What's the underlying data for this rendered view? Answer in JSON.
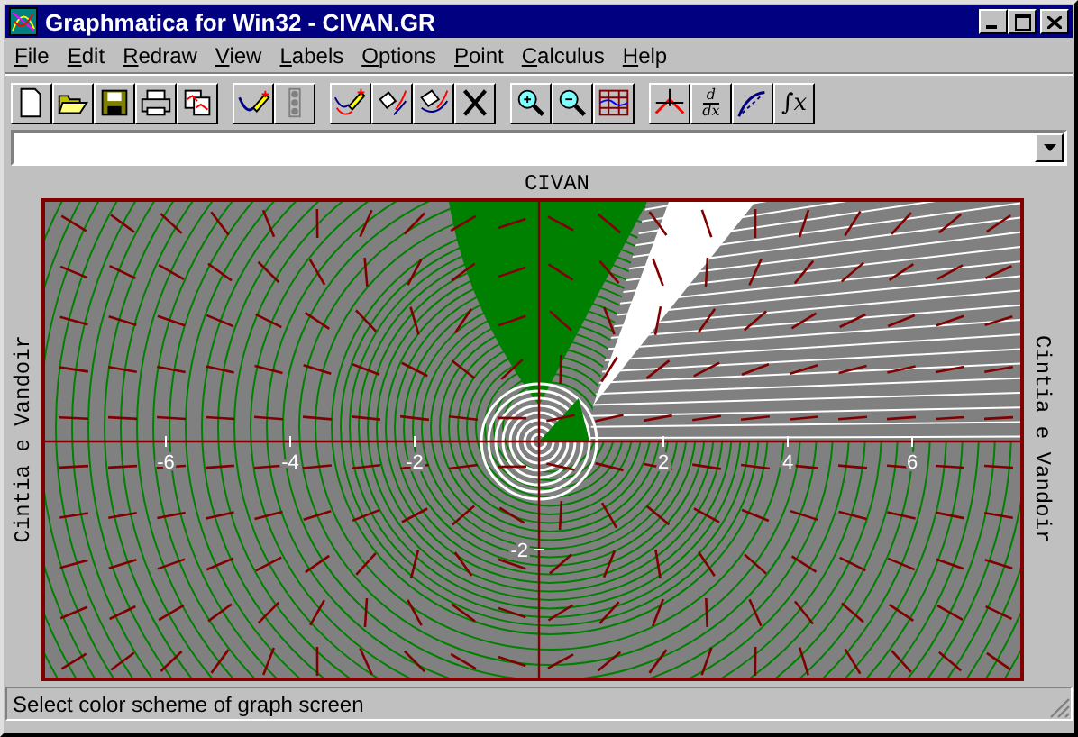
{
  "window": {
    "title": "Graphmatica for Win32 - CIVAN.GR"
  },
  "menu": [
    {
      "label": "File"
    },
    {
      "label": "Edit"
    },
    {
      "label": "Redraw"
    },
    {
      "label": "View"
    },
    {
      "label": "Labels"
    },
    {
      "label": "Options"
    },
    {
      "label": "Point"
    },
    {
      "label": "Calculus"
    },
    {
      "label": "Help"
    }
  ],
  "toolbar": {
    "derivative_button": {
      "numerator": "d",
      "denominator": "dx"
    },
    "integral_button": {
      "label": "∫x"
    }
  },
  "graph": {
    "title": "CIVAN",
    "left_label": "Cintia e Vandoir",
    "right_label": "Cintia e Vandoir",
    "x_tick_labels": [
      "-6",
      "-4",
      "-2",
      "2",
      "4",
      "6"
    ],
    "y_tick_labels": [
      "-2"
    ]
  },
  "status_bar": {
    "text": "Select color scheme of graph screen"
  }
}
